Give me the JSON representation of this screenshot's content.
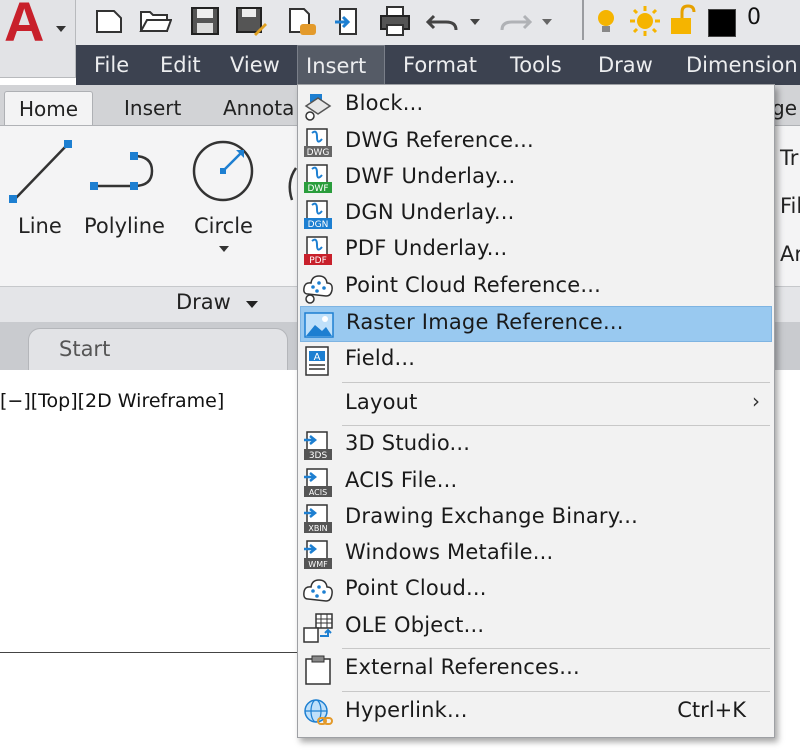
{
  "layer_number": "0",
  "menubar": [
    "File",
    "Edit",
    "View",
    "Insert",
    "Format",
    "Tools",
    "Draw",
    "Dimension"
  ],
  "ribbon_tabs": [
    "Home",
    "Insert",
    "Annota",
    "ge"
  ],
  "tools": {
    "line": "Line",
    "polyline": "Polyline",
    "circle": "Circle",
    "right1": "Tr",
    "right2": "Fil",
    "right3": "Ar"
  },
  "panel_title": "Draw",
  "file_tab": "Start",
  "viewport_label": "[−][Top][2D Wireframe]",
  "menu": {
    "items": [
      {
        "label": "Block...",
        "icon": "block-insert-icon"
      },
      {
        "label": "DWG Reference...",
        "icon": "dwg-reference-icon",
        "badge": "DWG"
      },
      {
        "label": "DWF Underlay...",
        "icon": "dwf-underlay-icon",
        "badge": "DWF"
      },
      {
        "label": "DGN Underlay...",
        "icon": "dgn-underlay-icon",
        "badge": "DGN"
      },
      {
        "label": "PDF Underlay...",
        "icon": "pdf-underlay-icon",
        "badge": "PDF"
      },
      {
        "label": "Point Cloud Reference...",
        "icon": "point-cloud-reference-icon"
      },
      {
        "label": "Raster Image Reference...",
        "icon": "raster-image-icon",
        "highlighted": true
      },
      {
        "label": "Field...",
        "icon": "field-icon"
      },
      {
        "label": "Layout",
        "submenu_arrow": "›"
      },
      {
        "label": "3D Studio...",
        "icon": "3d-studio-import-icon",
        "badge": "3DS"
      },
      {
        "label": "ACIS File...",
        "icon": "acis-import-icon",
        "badge": "ACIS"
      },
      {
        "label": "Drawing Exchange Binary...",
        "icon": "dxb-import-icon",
        "badge": "XBIN"
      },
      {
        "label": "Windows Metafile...",
        "icon": "wmf-import-icon",
        "badge": "WMF"
      },
      {
        "label": "Point Cloud...",
        "icon": "point-cloud-icon"
      },
      {
        "label": "OLE Object...",
        "icon": "ole-object-icon"
      },
      {
        "label": "External References...",
        "icon": "external-references-icon"
      },
      {
        "label": "Hyperlink...",
        "icon": "hyperlink-icon",
        "shortcut": "Ctrl+K"
      }
    ]
  },
  "colors": {
    "menubar_bg": "#3c4250",
    "highlight": "#99c9f0",
    "app_logo": "#c8202b",
    "accent_blue": "#1d7fd1"
  }
}
